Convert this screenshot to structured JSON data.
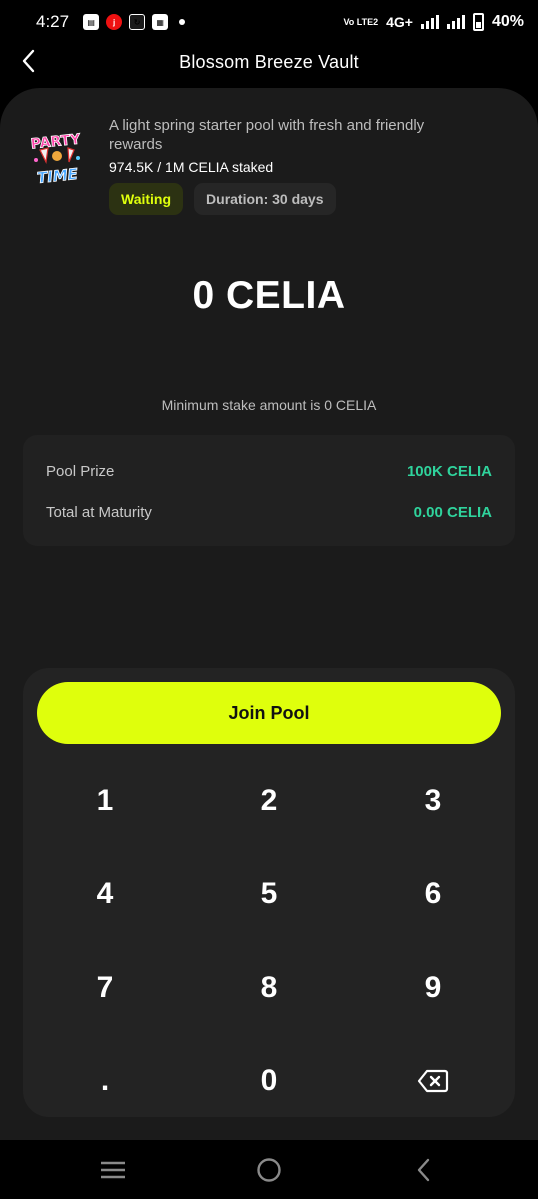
{
  "status_bar": {
    "time": "4:27",
    "volte": "Vo LTE2",
    "network": "4G+",
    "battery": "40%"
  },
  "header": {
    "title": "Blossom Breeze Vault"
  },
  "pool": {
    "logo_text_top": "PARTY",
    "logo_text_bottom": "TIME",
    "description": "A light spring starter pool with fresh and friendly rewards",
    "staked": "974.5K / 1M CELIA staked",
    "status_badge": "Waiting",
    "duration_badge": "Duration: 30 days"
  },
  "amount": "0 CELIA",
  "min_stake": "Minimum stake amount is 0 CELIA",
  "summary": {
    "rows": [
      {
        "label": "Pool Prize",
        "value": "100K CELIA"
      },
      {
        "label": "Total at Maturity",
        "value": "0.00 CELIA"
      }
    ]
  },
  "join_button": "Join Pool",
  "keypad": {
    "keys": [
      "1",
      "2",
      "3",
      "4",
      "5",
      "6",
      "7",
      "8",
      "9",
      ".",
      "0"
    ],
    "backspace_icon": "backspace-icon"
  },
  "colors": {
    "accent": "#dfff0c",
    "positive": "#2fd39c",
    "card": "#1b1b1b"
  }
}
